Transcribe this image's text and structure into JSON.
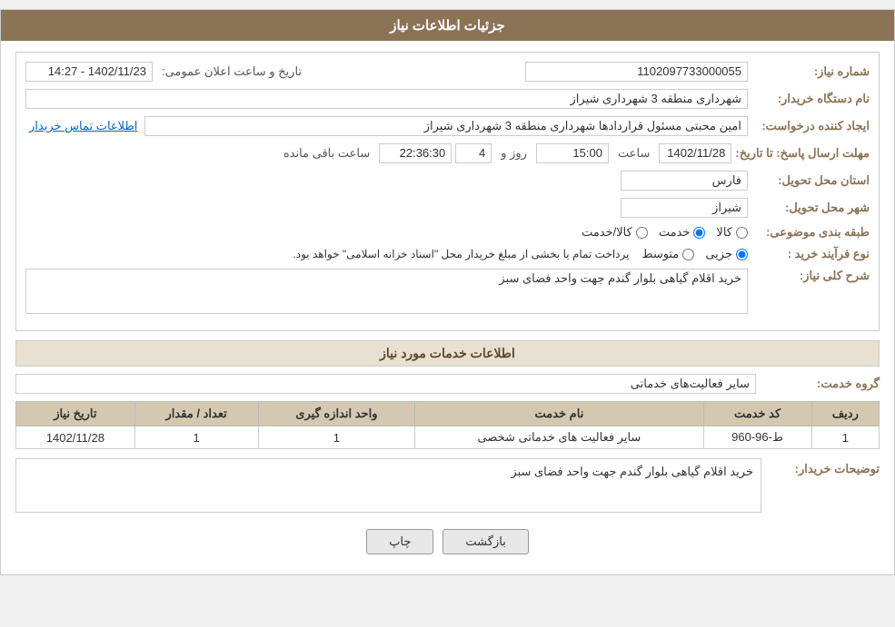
{
  "header": {
    "title": "جزئیات اطلاعات نیاز"
  },
  "fields": {
    "need_number_label": "شماره نیاز:",
    "need_number_value": "1102097733000055",
    "buyer_org_label": "نام دستگاه خریدار:",
    "buyer_org_value": "شهرداری منطقه 3 شهرداری شیراز",
    "creator_label": "ایجاد کننده درخواست:",
    "creator_value": "امین محبتی مسئول قراردادها شهرداری منطقه 3 شهرداری شیراز",
    "contact_link": "اطلاعات تماس خریدار",
    "announcement_date_label": "تاریخ و ساعت اعلان عمومی:",
    "announcement_date_value": "1402/11/23 - 14:27",
    "response_deadline_label": "مهلت ارسال پاسخ: تا تاریخ:",
    "response_date": "1402/11/28",
    "response_time_label": "ساعت",
    "response_time": "15:00",
    "response_days_label": "روز و",
    "response_days": "4",
    "response_remaining_label": "ساعت باقی مانده",
    "response_remaining": "22:36:30",
    "province_label": "استان محل تحویل:",
    "province_value": "فارس",
    "city_label": "شهر محل تحویل:",
    "city_value": "شیراز",
    "category_label": "طبقه بندی موضوعی:",
    "category_options": [
      "کالا",
      "خدمت",
      "کالا/خدمت"
    ],
    "category_selected": "خدمت",
    "purchase_type_label": "نوع فرآیند خرید :",
    "purchase_options": [
      "جزیی",
      "متوسط"
    ],
    "purchase_notice": "پرداخت تمام یا بخشی از مبلغ خریدار محل \"اسناد خزانه اسلامی\" خواهد بود.",
    "need_description_label": "شرح کلی نیاز:",
    "need_description_value": "خرید اقلام گیاهی بلوار گندم جهت واحد فضای سبز"
  },
  "services_section": {
    "title": "اطلاعات خدمات مورد نیاز",
    "service_group_label": "گروه خدمت:",
    "service_group_value": "سایر فعالیت‌های خدماتی",
    "table": {
      "headers": [
        "ردیف",
        "کد خدمت",
        "نام خدمت",
        "واحد اندازه گیری",
        "تعداد / مقدار",
        "تاریخ نیاز"
      ],
      "rows": [
        {
          "row_num": "1",
          "service_code": "ط-96-960",
          "service_name": "سایر فعالیت های خدماتی شخصی",
          "unit": "1",
          "quantity": "1",
          "date": "1402/11/28"
        }
      ]
    }
  },
  "buyer_comments": {
    "label": "توضیحات خریدار:",
    "value": "خرید اقلام گیاهی بلوار گندم جهت واحد فضای سبز"
  },
  "buttons": {
    "print": "چاپ",
    "back": "بازگشت"
  }
}
